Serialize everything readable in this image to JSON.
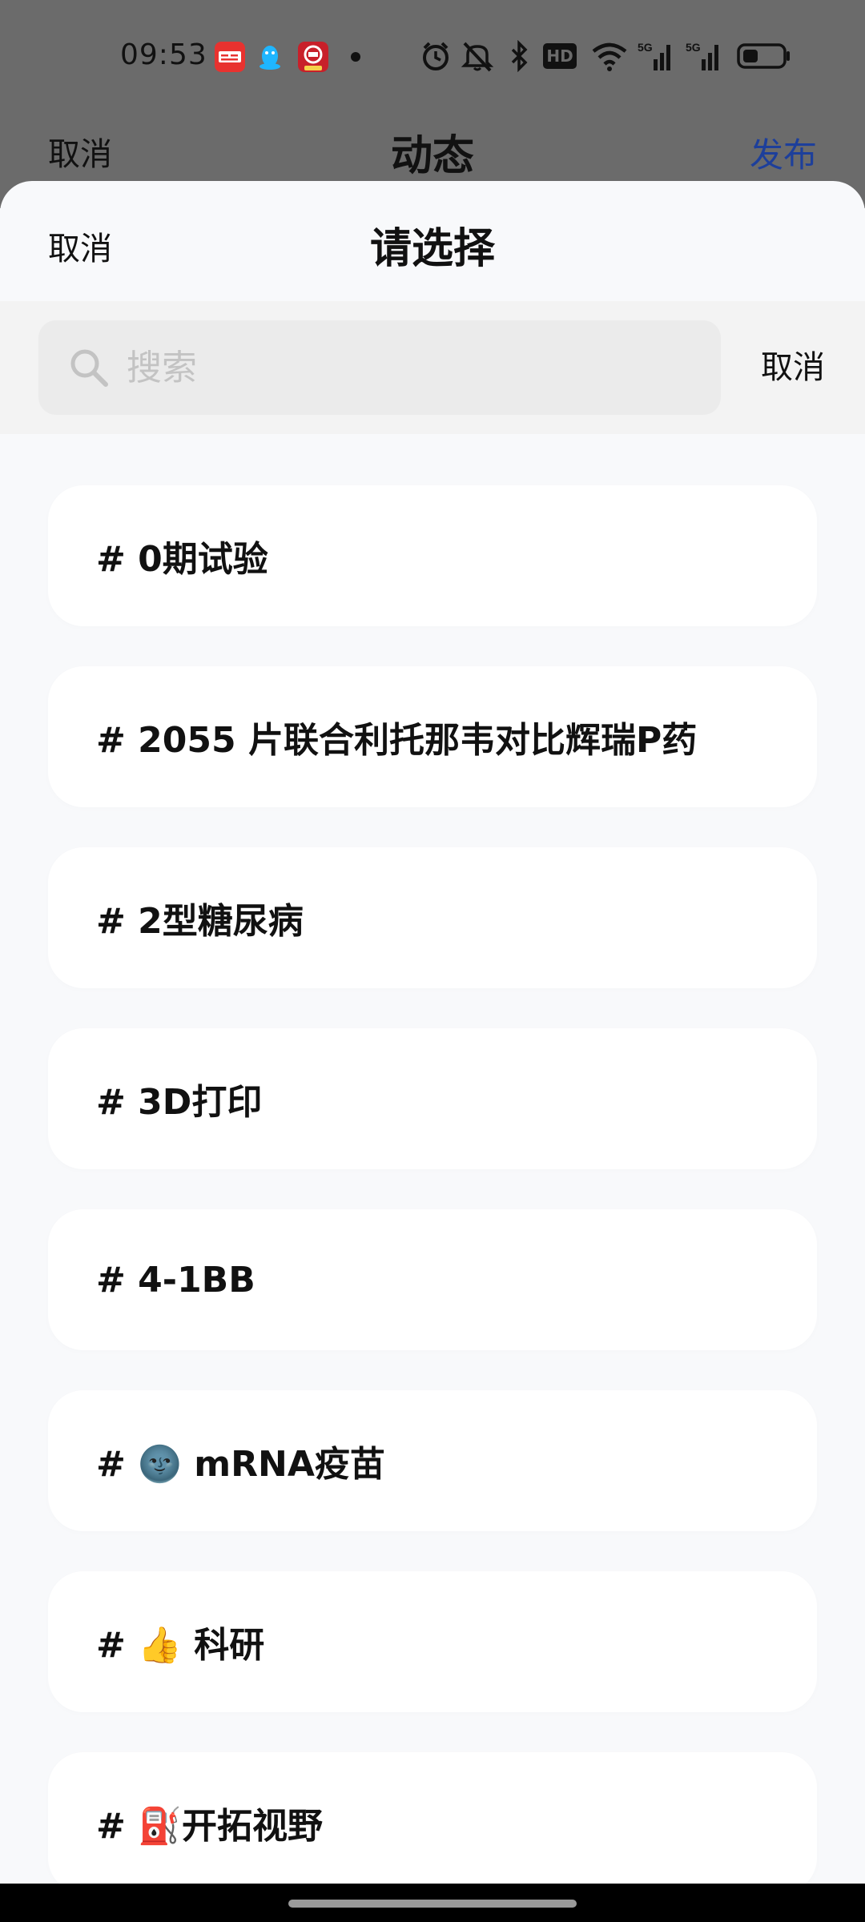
{
  "status_bar": {
    "time": "09:53",
    "notification_icons": [
      "toutiao-app-icon",
      "qq-app-icon",
      "bank-app-icon"
    ],
    "system_icons": [
      "alarm-icon",
      "mute-icon",
      "bluetooth-icon",
      "hd-icon",
      "wifi-icon",
      "signal-5g-icon",
      "signal-5g-icon",
      "battery-icon"
    ],
    "hd_label": "HD",
    "signal_label": "5G"
  },
  "underlay": {
    "cancel_label": "取消",
    "title": "动态",
    "publish_label": "发布",
    "publish_color": "#1d3f9b"
  },
  "sheet": {
    "cancel_label": "取消",
    "title": "请选择"
  },
  "search": {
    "placeholder": "搜索",
    "value": "",
    "cancel_label": "取消"
  },
  "topics": [
    {
      "label": "# 0期试验"
    },
    {
      "label": "# 2055 片联合利托那韦对比辉瑞P药"
    },
    {
      "label": "# 2型糖尿病"
    },
    {
      "label": "# 3D打印"
    },
    {
      "label": "# 4-1BB"
    },
    {
      "label": "# 🌚 mRNA疫苗"
    },
    {
      "label": "# 👍 科研"
    },
    {
      "label": "# ⛽开拓视野"
    }
  ]
}
